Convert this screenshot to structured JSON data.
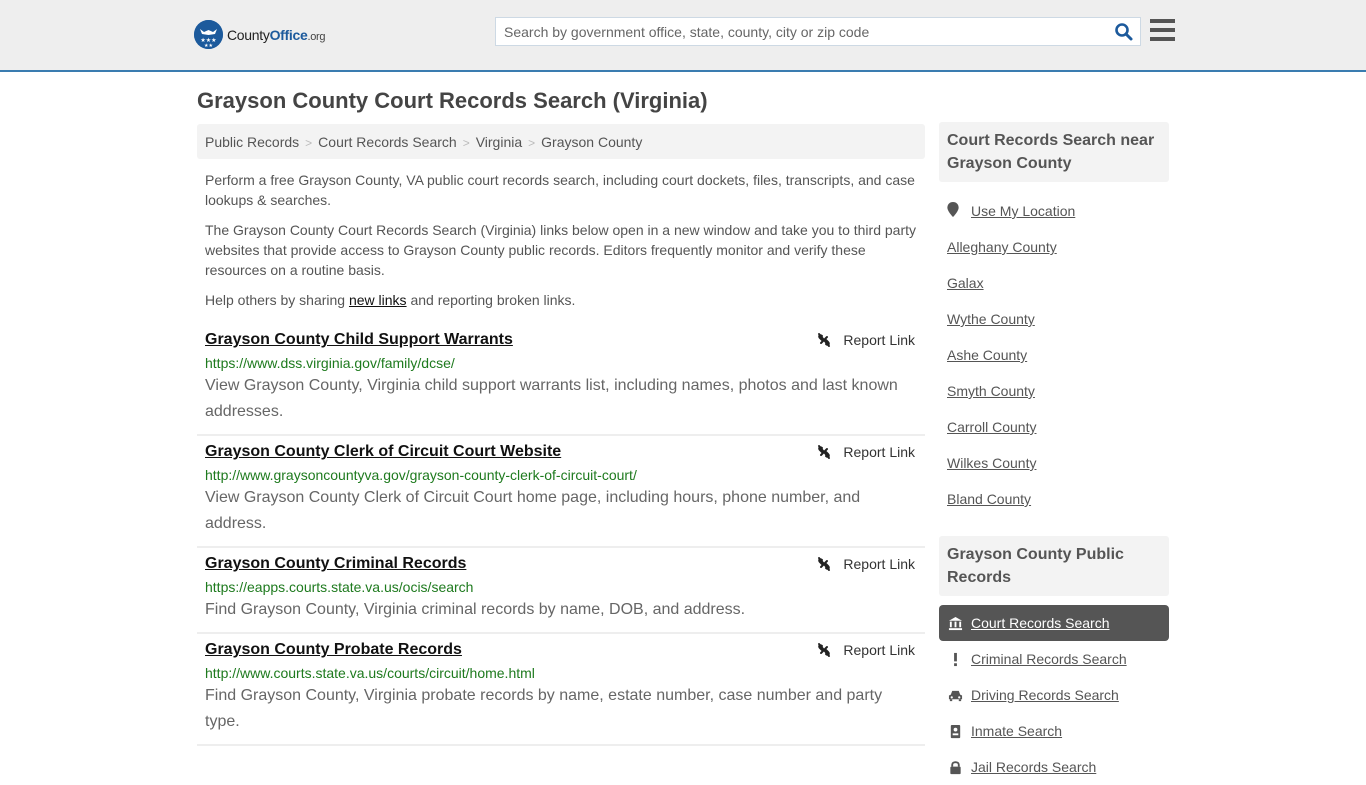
{
  "header": {
    "logo": {
      "county": "County",
      "office": "Office",
      "org": ".org"
    },
    "search": {
      "placeholder": "Search by government office, state, county, city or zip code",
      "value": ""
    },
    "colors": {
      "accent": "#1c5a9c",
      "border": "#3a7cb0"
    }
  },
  "page": {
    "title": "Grayson County Court Records Search (Virginia)",
    "breadcrumb": [
      "Public Records",
      "Court Records Search",
      "Virginia",
      "Grayson County"
    ],
    "intro": {
      "p1": "Perform a free Grayson County, VA public court records search, including court dockets, files, transcripts, and case lookups & searches.",
      "p2": "The Grayson County Court Records Search (Virginia) links below open in a new window and take you to third party websites that provide access to Grayson County public records. Editors frequently monitor and verify these resources on a routine basis.",
      "p3_before": "Help others by sharing ",
      "p3_link": "new links",
      "p3_after": " and reporting broken links."
    }
  },
  "results": [
    {
      "title": "Grayson County Child Support Warrants",
      "url": "https://www.dss.virginia.gov/family/dcse/",
      "description": "View Grayson County, Virginia child support warrants list, including names, photos and last known addresses.",
      "report_label": "Report Link"
    },
    {
      "title": "Grayson County Clerk of Circuit Court Website",
      "url": "http://www.graysoncountyva.gov/grayson-county-clerk-of-circuit-court/",
      "description": "View Grayson County Clerk of Circuit Court home page, including hours, phone number, and address.",
      "report_label": "Report Link"
    },
    {
      "title": "Grayson County Criminal Records",
      "url": "https://eapps.courts.state.va.us/ocis/search",
      "description": "Find Grayson County, Virginia criminal records by name, DOB, and address.",
      "report_label": "Report Link"
    },
    {
      "title": "Grayson County Probate Records",
      "url": "http://www.courts.state.va.us/courts/circuit/home.html",
      "description": "Find Grayson County, Virginia probate records by name, estate number, case number and party type.",
      "report_label": "Report Link"
    }
  ],
  "sidebar": {
    "nearby": {
      "heading": "Court Records Search near Grayson County",
      "use_location": "Use My Location",
      "places": [
        "Alleghany County",
        "Galax",
        "Wythe County",
        "Ashe County",
        "Smyth County",
        "Carroll County",
        "Wilkes County",
        "Bland County"
      ]
    },
    "records": {
      "heading": "Grayson County Public Records",
      "items": [
        {
          "label": "Court Records Search",
          "icon": "courthouse-icon",
          "active": true
        },
        {
          "label": "Criminal Records Search",
          "icon": "exclamation-icon",
          "active": false
        },
        {
          "label": "Driving Records Search",
          "icon": "car-icon",
          "active": false
        },
        {
          "label": "Inmate Search",
          "icon": "id-badge-icon",
          "active": false
        },
        {
          "label": "Jail Records Search",
          "icon": "lock-icon",
          "active": false
        }
      ]
    }
  }
}
